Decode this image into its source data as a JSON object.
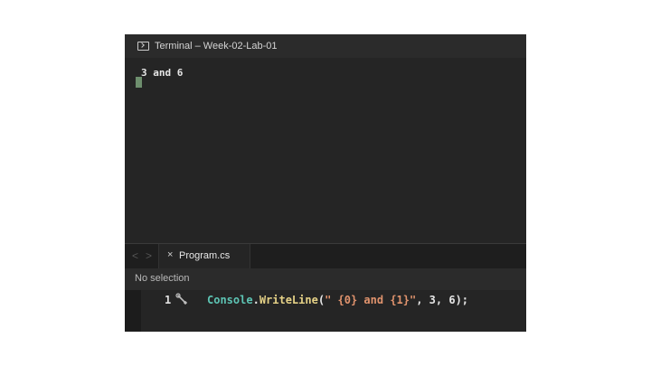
{
  "terminal": {
    "title": "Terminal – Week-02-Lab-01",
    "output": "3 and 6"
  },
  "editor": {
    "tab": {
      "label": "Program.cs",
      "close": "×"
    },
    "nav": {
      "back": "<",
      "forward": ">"
    },
    "selection_status": "No selection",
    "line_number": "1",
    "code": {
      "class_name": "Console",
      "dot": ".",
      "method": "WriteLine",
      "open_paren": "(",
      "string_literal": "\" {0} and {1}\"",
      "args": ", 3, 6);"
    }
  },
  "colors": {
    "background": "#252525",
    "class_name": "#5dc4b4",
    "method": "#e6d287",
    "string": "#e0936d",
    "cursor": "#6e8f6e"
  },
  "icons": [
    "terminal-icon",
    "wrench-icon",
    "close-icon",
    "chevron-left-icon",
    "chevron-right-icon"
  ]
}
